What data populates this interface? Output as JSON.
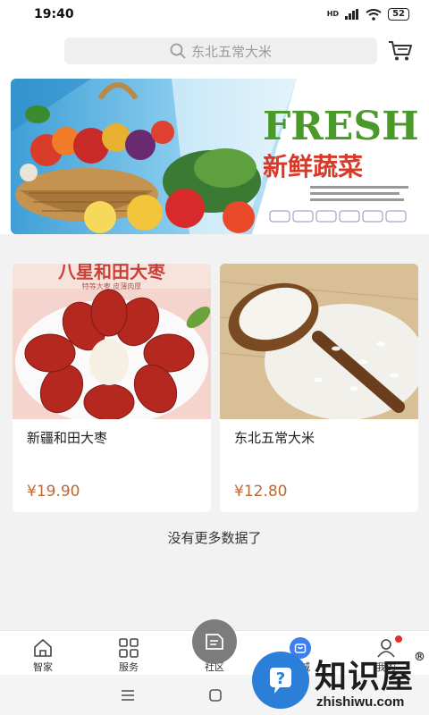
{
  "status_bar": {
    "time": "19:40",
    "network": "HD",
    "battery": "52"
  },
  "search": {
    "placeholder": "东北五常大米"
  },
  "banner": {
    "headline": "FRESH",
    "subtitle": "新鲜蔬菜"
  },
  "products": [
    {
      "name": "新疆和田大枣",
      "price": "¥19.90",
      "image_caption": "特等大枣 皮薄肉厚"
    },
    {
      "name": "东北五常大米",
      "price": "¥12.80"
    }
  ],
  "list_end_text": "没有更多数据了",
  "tabbar": {
    "items": [
      {
        "label": "智家",
        "icon": "home-icon"
      },
      {
        "label": "服务",
        "icon": "grid-icon"
      },
      {
        "label": "社区",
        "icon": "community-icon"
      },
      {
        "label": "商城",
        "icon": "mall-icon"
      },
      {
        "label": "我的",
        "icon": "user-icon"
      }
    ]
  },
  "watermark": {
    "title": "知识屋",
    "url": "zhishiwu.com"
  },
  "colors": {
    "price": "#c06830",
    "mall_active": "#3b7ff2",
    "badge": "#e0302a",
    "watermark_blue": "#2c7fd8"
  }
}
